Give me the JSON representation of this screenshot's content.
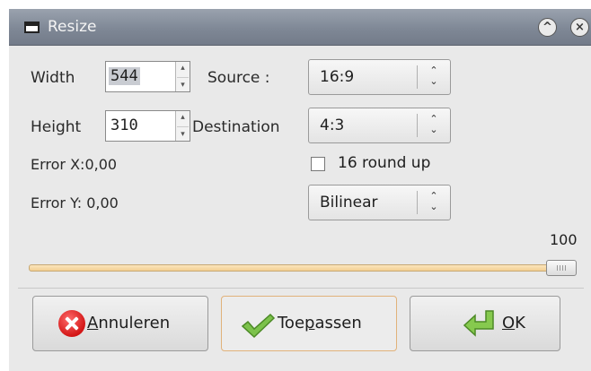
{
  "window": {
    "title": "Resize"
  },
  "labels": {
    "width": "Width",
    "height": "Height",
    "source": "Source :",
    "destination": "Destination",
    "error_x": "Error X:0,00",
    "error_y": "Error Y: 0,00"
  },
  "fields": {
    "width_value": "544",
    "height_value": "310"
  },
  "combos": {
    "source": "16:9",
    "destination": "4:3",
    "filter": "Bilinear"
  },
  "checkbox": {
    "label": "16 round up",
    "checked": false
  },
  "slider": {
    "value_text": "100",
    "value": 100,
    "max": 100
  },
  "buttons": {
    "cancel": {
      "mnemonic": "A",
      "rest": "nnuleren"
    },
    "apply": {
      "pre": "Toe",
      "mnemonic": "p",
      "post": "assen"
    },
    "ok": {
      "mnemonic": "O",
      "rest": "K"
    }
  },
  "icons": {
    "window": "window-icon",
    "minimize": "chevron-up-icon",
    "close": "close-icon",
    "cancel": "cancel-icon",
    "apply": "checkmark-icon",
    "ok": "enter-arrow-icon",
    "spin_up": "▴",
    "spin_down": "▾",
    "combo_up": "⌃",
    "combo_down": "⌄"
  },
  "colors": {
    "titlebar": "#7f8896",
    "slider_track": "#f3cf92",
    "cancel_red": "#d31616",
    "ok_green": "#7bc043"
  }
}
